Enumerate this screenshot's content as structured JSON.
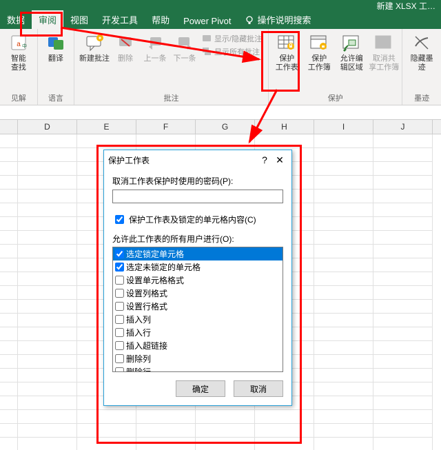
{
  "titlebar": "新建 XLSX 工…",
  "tabs": [
    "数据",
    "审阅",
    "视图",
    "开发工具",
    "帮助",
    "Power Pivot"
  ],
  "activeTab": 1,
  "searchHint": "操作说明搜索",
  "groups": {
    "a11y": {
      "btn": "智能\n查找",
      "label": "见解"
    },
    "lang": {
      "btn": "翻译",
      "label": "语言"
    },
    "comments": {
      "new": "新建批注",
      "del": "删除",
      "prev": "上一条",
      "next": "下一条",
      "s1": "显示/隐藏批注",
      "s2": "显示所有批注",
      "label": "批注"
    },
    "protect": {
      "sheet": "保护\n工作表",
      "book": "保护\n工作簿",
      "ranges": "允许编\n辑区域",
      "share": "取消共\n享工作簿",
      "label": "保护"
    },
    "ink": {
      "btn": "隐藏墨\n迹",
      "label": "墨迹"
    }
  },
  "cols": [
    "D",
    "E",
    "F",
    "G",
    "H",
    "I",
    "J"
  ],
  "dialog": {
    "title": "保护工作表",
    "pwLabel": "取消工作表保护时使用的密码(P):",
    "pwValue": "",
    "chk1": "保护工作表及锁定的单元格内容(C)",
    "listLabel": "允许此工作表的所有用户进行(O):",
    "items": [
      {
        "c": true,
        "t": "选定锁定单元格",
        "sel": true
      },
      {
        "c": true,
        "t": "选定未锁定的单元格"
      },
      {
        "c": false,
        "t": "设置单元格格式"
      },
      {
        "c": false,
        "t": "设置列格式"
      },
      {
        "c": false,
        "t": "设置行格式"
      },
      {
        "c": false,
        "t": "插入列"
      },
      {
        "c": false,
        "t": "插入行"
      },
      {
        "c": false,
        "t": "插入超链接"
      },
      {
        "c": false,
        "t": "删除列"
      },
      {
        "c": false,
        "t": "删除行"
      }
    ],
    "ok": "确定",
    "cancel": "取消"
  }
}
